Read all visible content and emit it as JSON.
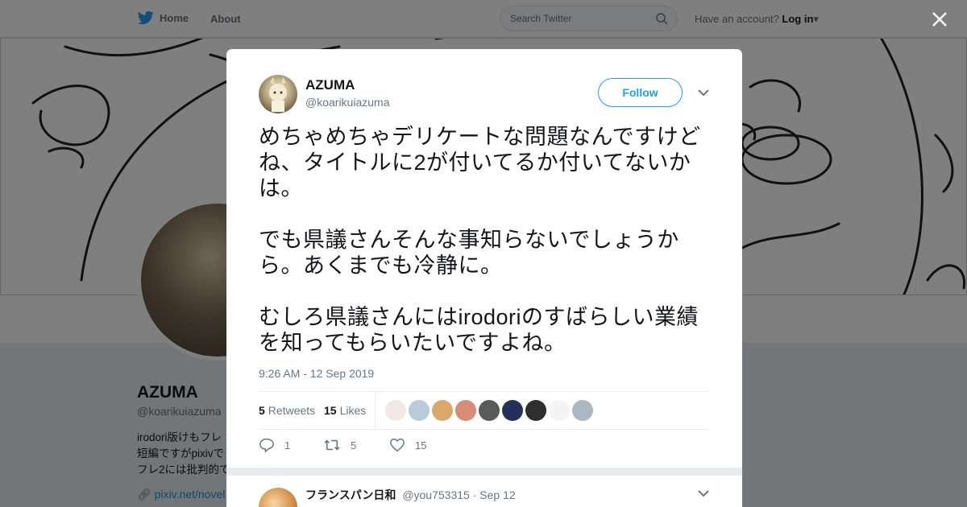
{
  "topbar": {
    "home_label": "Home",
    "about_label": "About",
    "search_placeholder": "Search Twitter",
    "account_prompt": "Have an account?",
    "login_label": "Log in"
  },
  "background_profile": {
    "name": "AZUMA",
    "handle": "@koarikuiazuma",
    "bio_lines": [
      "irodori版けもフレ",
      "短編ですがpixivで",
      "フレ2には批判的で"
    ],
    "link": "pixiv.net/novel"
  },
  "tweet": {
    "author_name": "AZUMA",
    "author_handle": "@koarikuiazuma",
    "follow_label": "Follow",
    "text": "めちゃめちゃデリケートな問題なんですけどね、タイトルに2が付いてるか付いてないかは。\n\nでも県議さんそんな事知らないでしょうから。あくまでも冷静に。\n\nむしろ県議さんにはirodoriのすばらしい業績を知ってもらいたいですよね。",
    "timestamp": "9:26 AM - 12 Sep 2019",
    "retweets_count": "5",
    "retweets_label": "Retweets",
    "likes_count": "15",
    "likes_label": "Likes",
    "action_reply_count": "1",
    "action_retweet_count": "5",
    "action_like_count": "15"
  },
  "likers": [
    {
      "icon": "liker-avatar-1",
      "color": "#f3e8e8"
    },
    {
      "icon": "liker-avatar-2",
      "color": "#b9cbd8"
    },
    {
      "icon": "liker-avatar-3",
      "color": "#d9a86a"
    },
    {
      "icon": "liker-avatar-4",
      "color": "#d88c78"
    },
    {
      "icon": "liker-avatar-5",
      "color": "#585c58"
    },
    {
      "icon": "liker-avatar-6",
      "color": "#24305c"
    },
    {
      "icon": "liker-avatar-7",
      "color": "#2e2e2e"
    },
    {
      "icon": "liker-avatar-8",
      "color": "#f4f4f4"
    },
    {
      "icon": "liker-avatar-default",
      "color": "#aab8c2"
    }
  ],
  "reply": {
    "name": "フランスパン日和",
    "handle": "@you753315",
    "date": "· Sep 12"
  },
  "colors": {
    "accent": "#1da1f2",
    "text_secondary": "#657786",
    "overlay": "rgba(0,0,0,0.5)"
  }
}
